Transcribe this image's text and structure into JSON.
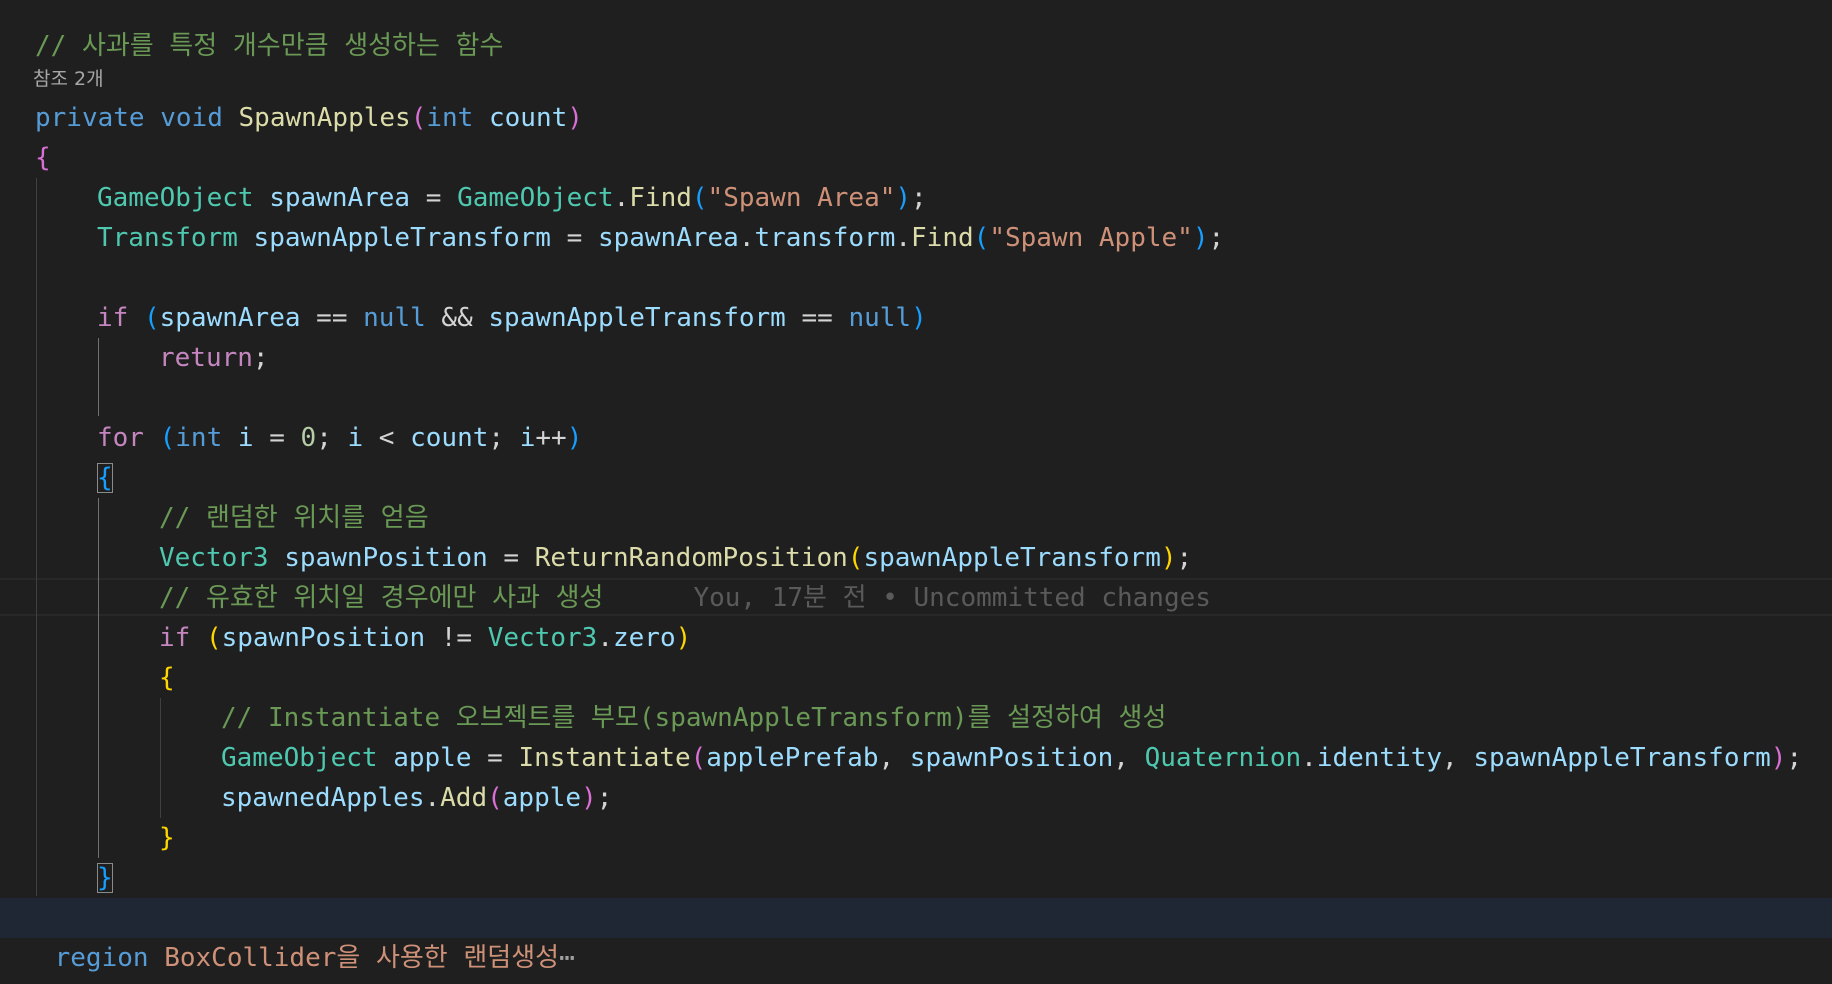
{
  "editor": {
    "codelens": "참조 2개",
    "blame": "You, 17분 전 • Uncommitted changes",
    "lines": [
      {
        "indent": 0,
        "tokens": [
          {
            "t": "// 사과를 특정 개수만큼 생성하는 함수",
            "c": "cm"
          }
        ]
      },
      {
        "indent": 0,
        "tokens": [
          {
            "t": "private",
            "c": "kw"
          },
          {
            "t": " "
          },
          {
            "t": "void",
            "c": "kw"
          },
          {
            "t": " "
          },
          {
            "t": "SpawnApples",
            "c": "fn"
          },
          {
            "t": "(",
            "c": "b1"
          },
          {
            "t": "int",
            "c": "kw"
          },
          {
            "t": " "
          },
          {
            "t": "count",
            "c": "var"
          },
          {
            "t": ")",
            "c": "b1"
          }
        ]
      },
      {
        "indent": 0,
        "tokens": [
          {
            "t": "{",
            "c": "b1"
          }
        ]
      },
      {
        "indent": 1,
        "tokens": [
          {
            "t": "GameObject",
            "c": "ty"
          },
          {
            "t": " "
          },
          {
            "t": "spawnArea",
            "c": "var"
          },
          {
            "t": " = "
          },
          {
            "t": "GameObject",
            "c": "ty"
          },
          {
            "t": "."
          },
          {
            "t": "Find",
            "c": "fn"
          },
          {
            "t": "(",
            "c": "b2"
          },
          {
            "t": "\"Spawn Area\"",
            "c": "str"
          },
          {
            "t": ")",
            "c": "b2"
          },
          {
            "t": ";"
          }
        ]
      },
      {
        "indent": 1,
        "tokens": [
          {
            "t": "Transform",
            "c": "ty"
          },
          {
            "t": " "
          },
          {
            "t": "spawnAppleTransform",
            "c": "var"
          },
          {
            "t": " = "
          },
          {
            "t": "spawnArea",
            "c": "var"
          },
          {
            "t": "."
          },
          {
            "t": "transform",
            "c": "var"
          },
          {
            "t": "."
          },
          {
            "t": "Find",
            "c": "fn"
          },
          {
            "t": "(",
            "c": "b2"
          },
          {
            "t": "\"Spawn Apple\"",
            "c": "str"
          },
          {
            "t": ")",
            "c": "b2"
          },
          {
            "t": ";"
          }
        ]
      },
      {
        "indent": 1,
        "tokens": []
      },
      {
        "indent": 1,
        "tokens": [
          {
            "t": "if",
            "c": "ctl"
          },
          {
            "t": " "
          },
          {
            "t": "(",
            "c": "b2"
          },
          {
            "t": "spawnArea",
            "c": "var"
          },
          {
            "t": " == "
          },
          {
            "t": "null",
            "c": "kw"
          },
          {
            "t": " && "
          },
          {
            "t": "spawnAppleTransform",
            "c": "var"
          },
          {
            "t": " == "
          },
          {
            "t": "null",
            "c": "kw"
          },
          {
            "t": ")",
            "c": "b2"
          }
        ]
      },
      {
        "indent": 2,
        "tokens": [
          {
            "t": "return",
            "c": "ctl"
          },
          {
            "t": ";"
          }
        ]
      },
      {
        "indent": 1,
        "tokens": []
      },
      {
        "indent": 1,
        "tokens": [
          {
            "t": "for",
            "c": "ctl"
          },
          {
            "t": " "
          },
          {
            "t": "(",
            "c": "b2"
          },
          {
            "t": "int",
            "c": "kw"
          },
          {
            "t": " "
          },
          {
            "t": "i",
            "c": "var"
          },
          {
            "t": " = "
          },
          {
            "t": "0",
            "c": "num"
          },
          {
            "t": "; "
          },
          {
            "t": "i",
            "c": "var"
          },
          {
            "t": " < "
          },
          {
            "t": "count",
            "c": "var"
          },
          {
            "t": "; "
          },
          {
            "t": "i",
            "c": "var"
          },
          {
            "t": "++"
          },
          {
            "t": ")",
            "c": "b2"
          }
        ]
      },
      {
        "indent": 1,
        "tokens": [
          {
            "t": "{",
            "c": "b2",
            "box": true
          }
        ]
      },
      {
        "indent": 2,
        "tokens": [
          {
            "t": "// 랜덤한 위치를 얻음",
            "c": "cm"
          }
        ]
      },
      {
        "indent": 2,
        "tokens": [
          {
            "t": "Vector3",
            "c": "ty"
          },
          {
            "t": " "
          },
          {
            "t": "spawnPosition",
            "c": "var"
          },
          {
            "t": " = "
          },
          {
            "t": "ReturnRandomPosition",
            "c": "fn"
          },
          {
            "t": "(",
            "c": "b3"
          },
          {
            "t": "spawnAppleTransform",
            "c": "var"
          },
          {
            "t": ")",
            "c": "b3"
          },
          {
            "t": ";"
          }
        ]
      },
      {
        "indent": 2,
        "tokens": [
          {
            "t": "// 유효한 위치일 경우에만 사과 생성",
            "c": "cm"
          }
        ],
        "blame": true
      },
      {
        "indent": 2,
        "tokens": [
          {
            "t": "if",
            "c": "ctl"
          },
          {
            "t": " "
          },
          {
            "t": "(",
            "c": "b3"
          },
          {
            "t": "spawnPosition",
            "c": "var"
          },
          {
            "t": " != "
          },
          {
            "t": "Vector3",
            "c": "ty"
          },
          {
            "t": "."
          },
          {
            "t": "zero",
            "c": "var"
          },
          {
            "t": ")",
            "c": "b3"
          }
        ]
      },
      {
        "indent": 2,
        "tokens": [
          {
            "t": "{",
            "c": "b3"
          }
        ]
      },
      {
        "indent": 3,
        "tokens": [
          {
            "t": "// Instantiate 오브젝트를 부모(spawnAppleTransform)를 설정하여 생성",
            "c": "cm"
          }
        ]
      },
      {
        "indent": 3,
        "tokens": [
          {
            "t": "GameObject",
            "c": "ty"
          },
          {
            "t": " "
          },
          {
            "t": "apple",
            "c": "var"
          },
          {
            "t": " = "
          },
          {
            "t": "Instantiate",
            "c": "fn"
          },
          {
            "t": "(",
            "c": "b1"
          },
          {
            "t": "applePrefab",
            "c": "var"
          },
          {
            "t": ", "
          },
          {
            "t": "spawnPosition",
            "c": "var"
          },
          {
            "t": ", "
          },
          {
            "t": "Quaternion",
            "c": "ty"
          },
          {
            "t": "."
          },
          {
            "t": "identity",
            "c": "var"
          },
          {
            "t": ", "
          },
          {
            "t": "spawnAppleTransform",
            "c": "var"
          },
          {
            "t": ")",
            "c": "b1"
          },
          {
            "t": ";"
          }
        ]
      },
      {
        "indent": 3,
        "tokens": [
          {
            "t": "spawnedApples",
            "c": "var"
          },
          {
            "t": "."
          },
          {
            "t": "Add",
            "c": "fn"
          },
          {
            "t": "(",
            "c": "b1"
          },
          {
            "t": "apple",
            "c": "var"
          },
          {
            "t": ")",
            "c": "b1"
          },
          {
            "t": ";"
          }
        ]
      },
      {
        "indent": 2,
        "tokens": [
          {
            "t": "}",
            "c": "b3"
          }
        ]
      },
      {
        "indent": 1,
        "tokens": [
          {
            "t": "}",
            "c": "b2",
            "box": true
          }
        ]
      }
    ],
    "region": {
      "keyword": "region",
      "name": "BoxCollider을 사용한 랜덤생성",
      "ellipsis": "⋯"
    },
    "closing": "}"
  }
}
